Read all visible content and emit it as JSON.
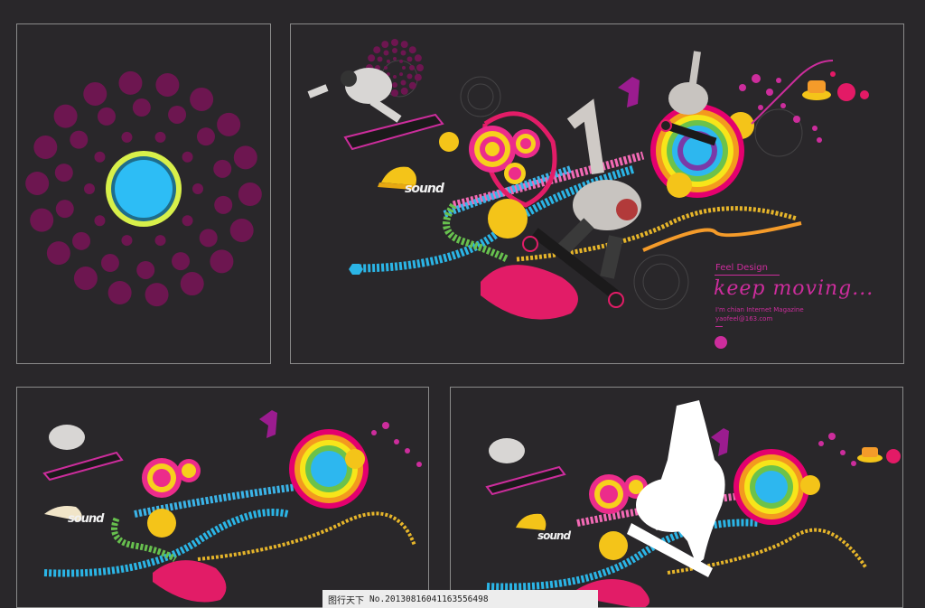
{
  "panels": {
    "p1": {
      "name": "dots-circle-panel"
    },
    "p2": {
      "feel_design": "Feel Design",
      "headline": "keep moving...",
      "byline": "I'm chian  Internet Magazine",
      "email": "yaofeel@163.com",
      "sound": "sound"
    },
    "p3": {
      "sound": "sound"
    },
    "p4": {
      "sound": "sound"
    }
  },
  "watermark": {
    "site": "图行天下",
    "number": "No.20130816041163556498"
  },
  "colors": {
    "background": "#29272a",
    "magenta": "#cc2d9c",
    "dot": "#6d1650",
    "cyan": "#29b6f6",
    "lime": "#d8f04a",
    "yellow": "#f6d31c"
  }
}
